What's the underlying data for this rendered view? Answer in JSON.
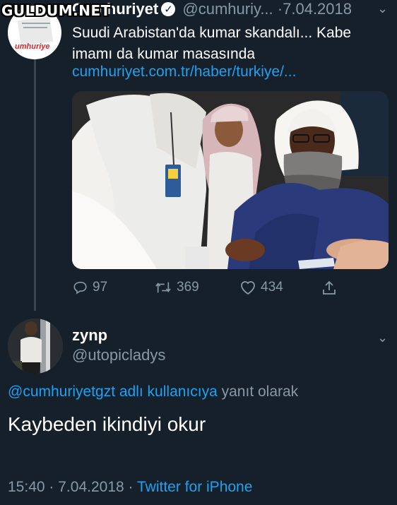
{
  "watermark": "GULDUM.NET",
  "tweet": {
    "name": "Cumhuriyet",
    "handle": "@cumhuriy...",
    "date_sep": "·",
    "date": "7.04.2018",
    "text": "Suudi Arabistan'da kumar skandalı... Kabe imamı da kumar masasında",
    "link": "cumhuriyet.com.tr/haber/turkiye/...",
    "avatar_logo": "umhuriye",
    "stats": {
      "replies": "97",
      "retweets": "369",
      "likes": "434"
    }
  },
  "reply": {
    "name": "zynp",
    "handle": "@utopicladys",
    "reply_mention": "@cumhuriyetgzt adlı kullanıcıya",
    "reply_suffix": "yanıt olarak",
    "text": "Kaybeden ikindiyi okur",
    "time": "15:40",
    "sep1": "·",
    "date": "7.04.2018",
    "sep2": "·",
    "source": "Twitter for iPhone"
  },
  "icons": {
    "reply": "reply-icon",
    "retweet": "retweet-icon",
    "like": "heart-icon",
    "share": "share-icon",
    "caret": "chevron-down-icon",
    "verified": "verified-badge-icon"
  },
  "colors": {
    "background": "#15202b",
    "link": "#1da1f2",
    "muted": "#8899a6"
  }
}
